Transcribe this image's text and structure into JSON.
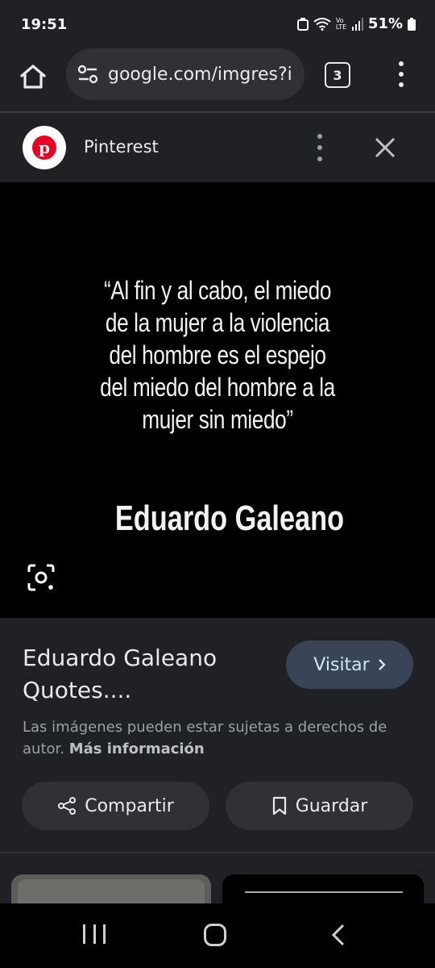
{
  "status_bar": {
    "time": "19:51",
    "network_label": "Vo LTE",
    "battery": "51%"
  },
  "browser": {
    "url": "google.com/imgres?i",
    "tab_count": "3"
  },
  "source": {
    "name": "Pinterest"
  },
  "image": {
    "quote_lines": [
      "“Al fin y al cabo, el miedo",
      "de la mujer a la violencia",
      "del hombre es el espejo",
      "del miedo del hombre a la",
      "mujer sin miedo”"
    ],
    "author": "Eduardo Galeano"
  },
  "result": {
    "title": "Eduardo Galeano Quotes....",
    "visit_label": "Visitar",
    "copyright_text": "Las imágenes pueden estar sujetas a derechos de autor.",
    "more_info_label": "Más información",
    "share_label": "Compartir",
    "save_label": "Guardar"
  },
  "colors": {
    "background": "#202124",
    "visit_button": "#394457",
    "pill_button": "#303134",
    "pinterest_red": "#e60023"
  },
  "icons": [
    "home-icon",
    "tune-icon",
    "tabs-icon",
    "more-vert-icon",
    "close-icon",
    "lens-icon",
    "chevron-right-icon",
    "share-icon",
    "bookmark-icon"
  ]
}
